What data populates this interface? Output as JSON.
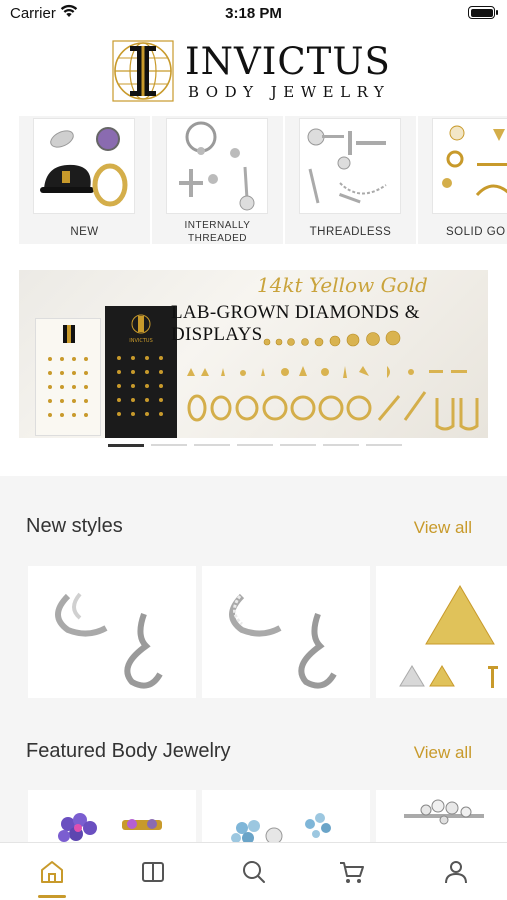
{
  "status_bar": {
    "carrier": "Carrier",
    "time": "3:18 PM"
  },
  "brand": {
    "name": "INVICTUS",
    "tagline": "BODY JEWELRY",
    "gold": "#c89a2b"
  },
  "categories": [
    {
      "label": "NEW"
    },
    {
      "label_line1": "INTERNALLY",
      "label_line2": "THREADED"
    },
    {
      "label": "THREADLESS"
    },
    {
      "label": "SOLID GO"
    }
  ],
  "banner": {
    "script_text": "14kt Yellow Gold",
    "headline": "LAB-GROWN DIAMONDS & DISPLAYS",
    "card_logo_text": "INVICTUS",
    "slide_count": 7,
    "active_slide": 1
  },
  "sections": {
    "new_styles": {
      "title": "New styles",
      "view_all": "View all"
    },
    "featured": {
      "title": "Featured Body Jewelry",
      "view_all": "View all"
    }
  },
  "tab_bar": {
    "items": [
      {
        "icon": "home-icon",
        "active": true
      },
      {
        "icon": "book-icon",
        "active": false
      },
      {
        "icon": "search-icon",
        "active": false
      },
      {
        "icon": "cart-icon",
        "active": false
      },
      {
        "icon": "user-icon",
        "active": false
      }
    ],
    "active_color": "#c89a2b",
    "inactive_color": "#555555"
  }
}
